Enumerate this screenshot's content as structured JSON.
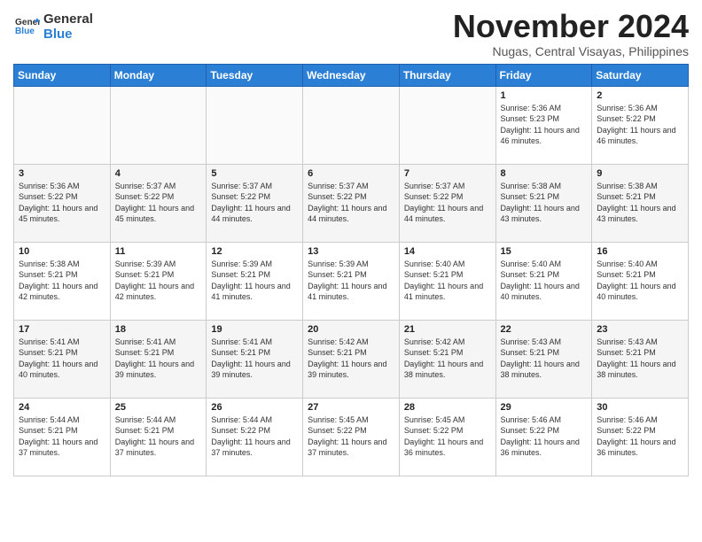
{
  "logo": {
    "line1": "General",
    "line2": "Blue"
  },
  "title": "November 2024",
  "subtitle": "Nugas, Central Visayas, Philippines",
  "weekdays": [
    "Sunday",
    "Monday",
    "Tuesday",
    "Wednesday",
    "Thursday",
    "Friday",
    "Saturday"
  ],
  "weeks": [
    [
      {
        "day": "",
        "info": ""
      },
      {
        "day": "",
        "info": ""
      },
      {
        "day": "",
        "info": ""
      },
      {
        "day": "",
        "info": ""
      },
      {
        "day": "",
        "info": ""
      },
      {
        "day": "1",
        "info": "Sunrise: 5:36 AM\nSunset: 5:23 PM\nDaylight: 11 hours and 46 minutes."
      },
      {
        "day": "2",
        "info": "Sunrise: 5:36 AM\nSunset: 5:22 PM\nDaylight: 11 hours and 46 minutes."
      }
    ],
    [
      {
        "day": "3",
        "info": "Sunrise: 5:36 AM\nSunset: 5:22 PM\nDaylight: 11 hours and 45 minutes."
      },
      {
        "day": "4",
        "info": "Sunrise: 5:37 AM\nSunset: 5:22 PM\nDaylight: 11 hours and 45 minutes."
      },
      {
        "day": "5",
        "info": "Sunrise: 5:37 AM\nSunset: 5:22 PM\nDaylight: 11 hours and 44 minutes."
      },
      {
        "day": "6",
        "info": "Sunrise: 5:37 AM\nSunset: 5:22 PM\nDaylight: 11 hours and 44 minutes."
      },
      {
        "day": "7",
        "info": "Sunrise: 5:37 AM\nSunset: 5:22 PM\nDaylight: 11 hours and 44 minutes."
      },
      {
        "day": "8",
        "info": "Sunrise: 5:38 AM\nSunset: 5:21 PM\nDaylight: 11 hours and 43 minutes."
      },
      {
        "day": "9",
        "info": "Sunrise: 5:38 AM\nSunset: 5:21 PM\nDaylight: 11 hours and 43 minutes."
      }
    ],
    [
      {
        "day": "10",
        "info": "Sunrise: 5:38 AM\nSunset: 5:21 PM\nDaylight: 11 hours and 42 minutes."
      },
      {
        "day": "11",
        "info": "Sunrise: 5:39 AM\nSunset: 5:21 PM\nDaylight: 11 hours and 42 minutes."
      },
      {
        "day": "12",
        "info": "Sunrise: 5:39 AM\nSunset: 5:21 PM\nDaylight: 11 hours and 41 minutes."
      },
      {
        "day": "13",
        "info": "Sunrise: 5:39 AM\nSunset: 5:21 PM\nDaylight: 11 hours and 41 minutes."
      },
      {
        "day": "14",
        "info": "Sunrise: 5:40 AM\nSunset: 5:21 PM\nDaylight: 11 hours and 41 minutes."
      },
      {
        "day": "15",
        "info": "Sunrise: 5:40 AM\nSunset: 5:21 PM\nDaylight: 11 hours and 40 minutes."
      },
      {
        "day": "16",
        "info": "Sunrise: 5:40 AM\nSunset: 5:21 PM\nDaylight: 11 hours and 40 minutes."
      }
    ],
    [
      {
        "day": "17",
        "info": "Sunrise: 5:41 AM\nSunset: 5:21 PM\nDaylight: 11 hours and 40 minutes."
      },
      {
        "day": "18",
        "info": "Sunrise: 5:41 AM\nSunset: 5:21 PM\nDaylight: 11 hours and 39 minutes."
      },
      {
        "day": "19",
        "info": "Sunrise: 5:41 AM\nSunset: 5:21 PM\nDaylight: 11 hours and 39 minutes."
      },
      {
        "day": "20",
        "info": "Sunrise: 5:42 AM\nSunset: 5:21 PM\nDaylight: 11 hours and 39 minutes."
      },
      {
        "day": "21",
        "info": "Sunrise: 5:42 AM\nSunset: 5:21 PM\nDaylight: 11 hours and 38 minutes."
      },
      {
        "day": "22",
        "info": "Sunrise: 5:43 AM\nSunset: 5:21 PM\nDaylight: 11 hours and 38 minutes."
      },
      {
        "day": "23",
        "info": "Sunrise: 5:43 AM\nSunset: 5:21 PM\nDaylight: 11 hours and 38 minutes."
      }
    ],
    [
      {
        "day": "24",
        "info": "Sunrise: 5:44 AM\nSunset: 5:21 PM\nDaylight: 11 hours and 37 minutes."
      },
      {
        "day": "25",
        "info": "Sunrise: 5:44 AM\nSunset: 5:21 PM\nDaylight: 11 hours and 37 minutes."
      },
      {
        "day": "26",
        "info": "Sunrise: 5:44 AM\nSunset: 5:22 PM\nDaylight: 11 hours and 37 minutes."
      },
      {
        "day": "27",
        "info": "Sunrise: 5:45 AM\nSunset: 5:22 PM\nDaylight: 11 hours and 37 minutes."
      },
      {
        "day": "28",
        "info": "Sunrise: 5:45 AM\nSunset: 5:22 PM\nDaylight: 11 hours and 36 minutes."
      },
      {
        "day": "29",
        "info": "Sunrise: 5:46 AM\nSunset: 5:22 PM\nDaylight: 11 hours and 36 minutes."
      },
      {
        "day": "30",
        "info": "Sunrise: 5:46 AM\nSunset: 5:22 PM\nDaylight: 11 hours and 36 minutes."
      }
    ]
  ]
}
